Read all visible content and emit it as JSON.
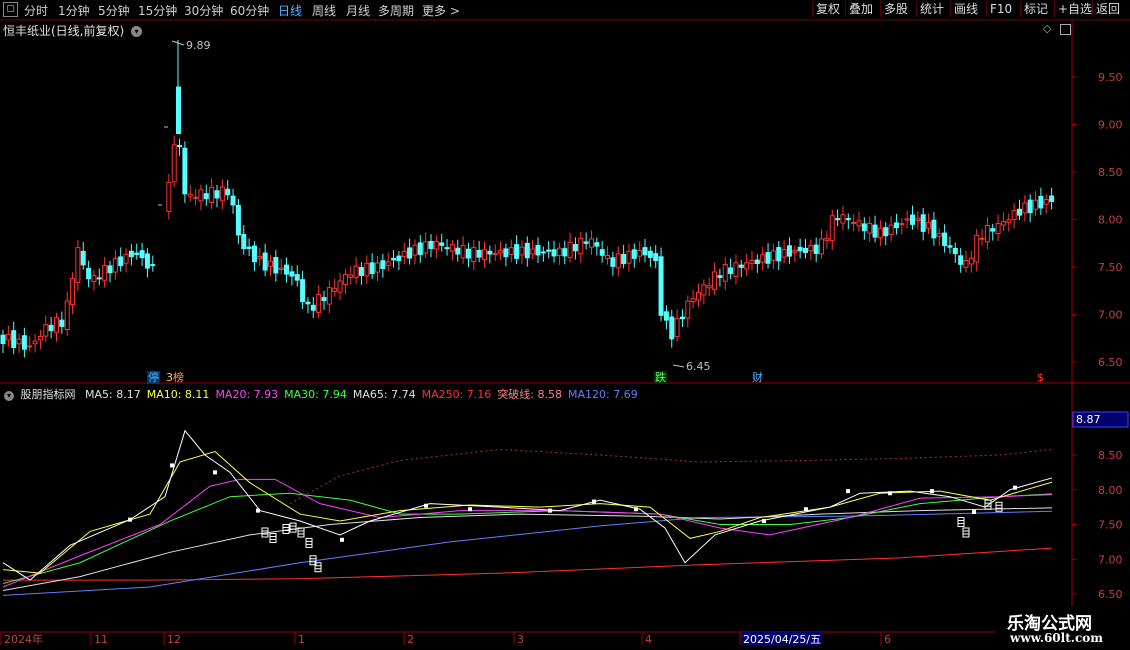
{
  "toolbar": {
    "left_tabs": [
      {
        "label": "分时",
        "active": false
      },
      {
        "label": "1分钟",
        "active": false
      },
      {
        "label": "5分钟",
        "active": false
      },
      {
        "label": "15分钟",
        "active": false
      },
      {
        "label": "30分钟",
        "active": false
      },
      {
        "label": "60分钟",
        "active": false
      },
      {
        "label": "日线",
        "active": true
      },
      {
        "label": "周线",
        "active": false
      },
      {
        "label": "月线",
        "active": false
      },
      {
        "label": "多周期",
        "active": false
      },
      {
        "label": "更多 >",
        "active": false
      }
    ],
    "right_buttons": [
      "复权",
      "叠加",
      "多股",
      "统计",
      "画线",
      "F10",
      "标记",
      "+自选",
      "返回"
    ]
  },
  "main_chart": {
    "title": "恒丰纸业(日线,前复权)",
    "high_label": "9.89",
    "low_label": "6.45",
    "y_ticks": [
      "9.50",
      "9.00",
      "8.50",
      "8.00",
      "7.50",
      "7.00",
      "6.50"
    ],
    "badges": [
      {
        "text": "停",
        "color": "#4fb4ff",
        "bg": "#003366"
      },
      {
        "text": "3",
        "color": "#ffd24a",
        "bg": "#3a2a00"
      },
      {
        "text": "榜",
        "color": "#ff9a3a",
        "bg": "#3a1a00"
      },
      {
        "text": "跌",
        "color": "#5cff5c",
        "bg": "#003300"
      },
      {
        "text": "财",
        "color": "#4fb4ff",
        "bg": "#000"
      },
      {
        "text": "$",
        "color": "#ff3a3a",
        "bg": "#000"
      }
    ]
  },
  "indicator": {
    "name": "股朋指标网",
    "values": [
      {
        "label": "MA5: 8.17",
        "color": "#e0e0e0"
      },
      {
        "label": "MA10: 8.11",
        "color": "#ffff40"
      },
      {
        "label": "MA20: 7.93",
        "color": "#ff40ff"
      },
      {
        "label": "MA30: 7.94",
        "color": "#40ff40"
      },
      {
        "label": "MA65: 7.74",
        "color": "#e0e0e0"
      },
      {
        "label": "MA250: 7.16",
        "color": "#ff3030"
      },
      {
        "label": "突破线: 8.58",
        "color": "#ff8080"
      },
      {
        "label": "MA120: 7.69",
        "color": "#6080ff"
      }
    ],
    "current_value": "8.87",
    "y_ticks": [
      "8.50",
      "8.00",
      "7.50",
      "7.00",
      "6.50"
    ]
  },
  "x_axis": {
    "labels": [
      "2024年",
      "11",
      "12",
      "1",
      "2",
      "3",
      "4",
      "2025/04/25/五",
      "6"
    ]
  },
  "watermark": {
    "line1": "乐淘公式网",
    "line2": "www.60lt.com"
  }
}
